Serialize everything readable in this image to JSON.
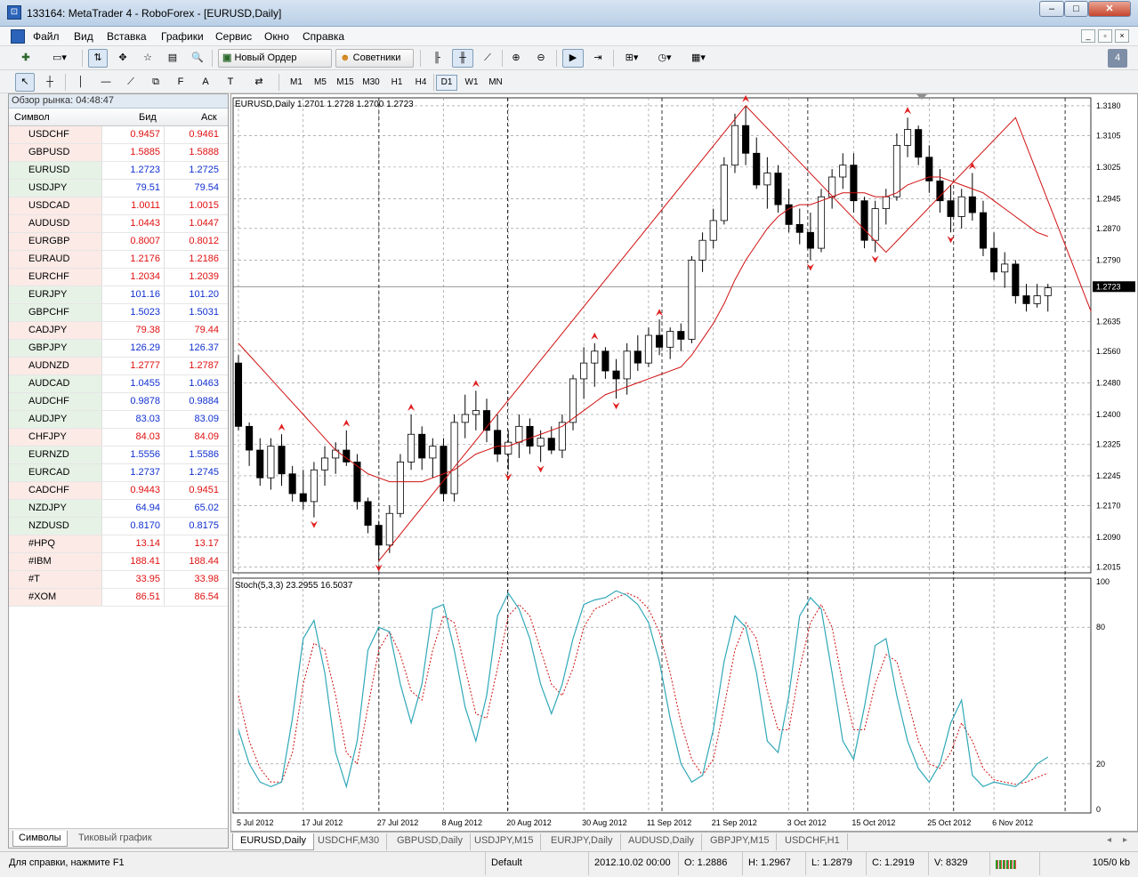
{
  "window": {
    "title": "133164: MetaTrader 4 - RoboForex - [EURUSD,Daily]",
    "icon_glyph": "⊡",
    "buttons": [
      "–",
      "□",
      "✕"
    ]
  },
  "menu": {
    "items": [
      "Файл",
      "Вид",
      "Вставка",
      "Графики",
      "Сервис",
      "Окно",
      "Справка"
    ],
    "mdi_buttons": [
      "_",
      "▫",
      "×"
    ]
  },
  "toolbar": {
    "new_order_label": "Новый Ордер",
    "experts_label": "Советники",
    "periods": [
      "M1",
      "M5",
      "M15",
      "M30",
      "H1",
      "H4",
      "D1",
      "W1",
      "MN"
    ],
    "active_period": "D1",
    "draw_tools": [
      "↖",
      "┼",
      "│",
      "—",
      "⟋",
      "⧉",
      "F",
      "A",
      "T",
      "⇄"
    ],
    "icons": [
      "new-chart-icon",
      "profiles-icon",
      "market-watch-icon",
      "navigator-icon",
      "data-window-icon",
      "terminal-icon",
      "strategy-tester-icon",
      "bar-chart-icon",
      "candle-chart-icon",
      "line-chart-icon",
      "zoom-in-icon",
      "zoom-out-icon",
      "autoscroll-icon",
      "chart-shift-icon",
      "indicators-icon",
      "periods-icon",
      "templates-icon"
    ]
  },
  "market_watch": {
    "title": "Обзор рынка: 04:48:47",
    "headers": {
      "symbol": "Символ",
      "bid": "Бид",
      "ask": "Аск"
    },
    "rows": [
      {
        "symbol": "USDCHF",
        "bid": "0.9457",
        "ask": "0.9461",
        "dir": "down"
      },
      {
        "symbol": "GBPUSD",
        "bid": "1.5885",
        "ask": "1.5888",
        "dir": "down"
      },
      {
        "symbol": "EURUSD",
        "bid": "1.2723",
        "ask": "1.2725",
        "dir": "up"
      },
      {
        "symbol": "USDJPY",
        "bid": "79.51",
        "ask": "79.54",
        "dir": "up"
      },
      {
        "symbol": "USDCAD",
        "bid": "1.0011",
        "ask": "1.0015",
        "dir": "down"
      },
      {
        "symbol": "AUDUSD",
        "bid": "1.0443",
        "ask": "1.0447",
        "dir": "down"
      },
      {
        "symbol": "EURGBP",
        "bid": "0.8007",
        "ask": "0.8012",
        "dir": "down"
      },
      {
        "symbol": "EURAUD",
        "bid": "1.2176",
        "ask": "1.2186",
        "dir": "down"
      },
      {
        "symbol": "EURCHF",
        "bid": "1.2034",
        "ask": "1.2039",
        "dir": "down"
      },
      {
        "symbol": "EURJPY",
        "bid": "101.16",
        "ask": "101.20",
        "dir": "up"
      },
      {
        "symbol": "GBPCHF",
        "bid": "1.5023",
        "ask": "1.5031",
        "dir": "up"
      },
      {
        "symbol": "CADJPY",
        "bid": "79.38",
        "ask": "79.44",
        "dir": "down"
      },
      {
        "symbol": "GBPJPY",
        "bid": "126.29",
        "ask": "126.37",
        "dir": "up"
      },
      {
        "symbol": "AUDNZD",
        "bid": "1.2777",
        "ask": "1.2787",
        "dir": "down"
      },
      {
        "symbol": "AUDCAD",
        "bid": "1.0455",
        "ask": "1.0463",
        "dir": "up"
      },
      {
        "symbol": "AUDCHF",
        "bid": "0.9878",
        "ask": "0.9884",
        "dir": "up"
      },
      {
        "symbol": "AUDJPY",
        "bid": "83.03",
        "ask": "83.09",
        "dir": "up"
      },
      {
        "symbol": "CHFJPY",
        "bid": "84.03",
        "ask": "84.09",
        "dir": "down"
      },
      {
        "symbol": "EURNZD",
        "bid": "1.5556",
        "ask": "1.5586",
        "dir": "up"
      },
      {
        "symbol": "EURCAD",
        "bid": "1.2737",
        "ask": "1.2745",
        "dir": "up"
      },
      {
        "symbol": "CADCHF",
        "bid": "0.9443",
        "ask": "0.9451",
        "dir": "down"
      },
      {
        "symbol": "NZDJPY",
        "bid": "64.94",
        "ask": "65.02",
        "dir": "up"
      },
      {
        "symbol": "NZDUSD",
        "bid": "0.8170",
        "ask": "0.8175",
        "dir": "up"
      },
      {
        "symbol": "#HPQ",
        "bid": "13.14",
        "ask": "13.17",
        "dir": "down"
      },
      {
        "symbol": "#IBM",
        "bid": "188.41",
        "ask": "188.44",
        "dir": "down"
      },
      {
        "symbol": "#T",
        "bid": "33.95",
        "ask": "33.98",
        "dir": "down"
      },
      {
        "symbol": "#XOM",
        "bid": "86.51",
        "ask": "86.54",
        "dir": "down"
      }
    ],
    "tabs": [
      "Символы",
      "Тиковый график"
    ]
  },
  "chart": {
    "header": "EURUSD,Daily  1.2701 1.2728 1.2700 1.2723",
    "current_price": "1.2723",
    "price_labels": [
      "1.3180",
      "1.3105",
      "1.3025",
      "1.2945",
      "1.2870",
      "1.2790",
      "1.2635",
      "1.2560",
      "1.2480",
      "1.2400",
      "1.2325",
      "1.2245",
      "1.2170",
      "1.2090",
      "1.2015"
    ],
    "date_labels": [
      "5 Jul 2012",
      "17 Jul 2012",
      "27 Jul 2012",
      "8 Aug 2012",
      "20 Aug 2012",
      "30 Aug 2012",
      "11 Sep 2012",
      "21 Sep 2012",
      "3 Oct 2012",
      "15 Oct 2012",
      "25 Oct 2012",
      "6 Nov 2012"
    ],
    "stoch_header": "Stoch(5,3,3) 23.2955 16.5037",
    "stoch_levels": [
      "100",
      "80",
      "20",
      "0"
    ],
    "colors": {
      "bull": "#ffffff",
      "bear": "#000000",
      "ma": "#d01010",
      "zigzag": "#d01010",
      "stoch_main": "#30a8b8",
      "stoch_signal": "#d01010",
      "grid": "#888888"
    }
  },
  "chart_data": {
    "type": "candlestick",
    "symbol": "EURUSD",
    "timeframe": "Daily",
    "ylim": [
      1.2,
      1.32
    ],
    "candles": [
      [
        1.253,
        1.255,
        1.236,
        1.237
      ],
      [
        1.237,
        1.238,
        1.227,
        1.231
      ],
      [
        1.231,
        1.234,
        1.222,
        1.224
      ],
      [
        1.224,
        1.234,
        1.221,
        1.232
      ],
      [
        1.232,
        1.235,
        1.222,
        1.225
      ],
      [
        1.225,
        1.227,
        1.218,
        1.22
      ],
      [
        1.22,
        1.226,
        1.216,
        1.218
      ],
      [
        1.218,
        1.228,
        1.214,
        1.226
      ],
      [
        1.226,
        1.232,
        1.222,
        1.229
      ],
      [
        1.229,
        1.233,
        1.225,
        1.231
      ],
      [
        1.231,
        1.236,
        1.227,
        1.228
      ],
      [
        1.228,
        1.23,
        1.216,
        1.218
      ],
      [
        1.218,
        1.219,
        1.21,
        1.212
      ],
      [
        1.212,
        1.213,
        1.203,
        1.207
      ],
      [
        1.207,
        1.217,
        1.205,
        1.215
      ],
      [
        1.215,
        1.23,
        1.214,
        1.228
      ],
      [
        1.228,
        1.24,
        1.226,
        1.235
      ],
      [
        1.235,
        1.237,
        1.226,
        1.229
      ],
      [
        1.229,
        1.234,
        1.224,
        1.232
      ],
      [
        1.232,
        1.234,
        1.218,
        1.22
      ],
      [
        1.22,
        1.24,
        1.218,
        1.238
      ],
      [
        1.238,
        1.245,
        1.234,
        1.24
      ],
      [
        1.24,
        1.246,
        1.236,
        1.241
      ],
      [
        1.241,
        1.244,
        1.233,
        1.236
      ],
      [
        1.236,
        1.24,
        1.228,
        1.23
      ],
      [
        1.23,
        1.236,
        1.226,
        1.233
      ],
      [
        1.233,
        1.24,
        1.229,
        1.237
      ],
      [
        1.237,
        1.239,
        1.23,
        1.232
      ],
      [
        1.232,
        1.236,
        1.228,
        1.234
      ],
      [
        1.234,
        1.237,
        1.23,
        1.231
      ],
      [
        1.231,
        1.24,
        1.229,
        1.238
      ],
      [
        1.238,
        1.25,
        1.236,
        1.249
      ],
      [
        1.249,
        1.257,
        1.244,
        1.253
      ],
      [
        1.253,
        1.258,
        1.247,
        1.256
      ],
      [
        1.256,
        1.257,
        1.249,
        1.251
      ],
      [
        1.251,
        1.254,
        1.244,
        1.249
      ],
      [
        1.249,
        1.258,
        1.245,
        1.256
      ],
      [
        1.256,
        1.26,
        1.251,
        1.253
      ],
      [
        1.253,
        1.262,
        1.252,
        1.26
      ],
      [
        1.26,
        1.264,
        1.255,
        1.257
      ],
      [
        1.257,
        1.262,
        1.254,
        1.261
      ],
      [
        1.261,
        1.263,
        1.256,
        1.259
      ],
      [
        1.259,
        1.28,
        1.258,
        1.279
      ],
      [
        1.279,
        1.286,
        1.276,
        1.284
      ],
      [
        1.284,
        1.292,
        1.282,
        1.289
      ],
      [
        1.289,
        1.305,
        1.288,
        1.303
      ],
      [
        1.303,
        1.316,
        1.301,
        1.313
      ],
      [
        1.313,
        1.318,
        1.303,
        1.306
      ],
      [
        1.306,
        1.31,
        1.297,
        1.298
      ],
      [
        1.298,
        1.305,
        1.292,
        1.301
      ],
      [
        1.301,
        1.303,
        1.291,
        1.293
      ],
      [
        1.293,
        1.297,
        1.286,
        1.288
      ],
      [
        1.288,
        1.292,
        1.283,
        1.286
      ],
      [
        1.286,
        1.291,
        1.279,
        1.282
      ],
      [
        1.282,
        1.297,
        1.281,
        1.295
      ],
      [
        1.295,
        1.302,
        1.292,
        1.3
      ],
      [
        1.3,
        1.306,
        1.297,
        1.303
      ],
      [
        1.303,
        1.306,
        1.291,
        1.294
      ],
      [
        1.294,
        1.295,
        1.282,
        1.284
      ],
      [
        1.284,
        1.294,
        1.281,
        1.292
      ],
      [
        1.292,
        1.297,
        1.288,
        1.295
      ],
      [
        1.295,
        1.311,
        1.294,
        1.308
      ],
      [
        1.308,
        1.315,
        1.305,
        1.312
      ],
      [
        1.312,
        1.313,
        1.303,
        1.305
      ],
      [
        1.305,
        1.308,
        1.296,
        1.299
      ],
      [
        1.299,
        1.302,
        1.291,
        1.294
      ],
      [
        1.294,
        1.298,
        1.286,
        1.29
      ],
      [
        1.29,
        1.297,
        1.287,
        1.295
      ],
      [
        1.295,
        1.301,
        1.289,
        1.291
      ],
      [
        1.291,
        1.294,
        1.28,
        1.282
      ],
      [
        1.282,
        1.286,
        1.274,
        1.276
      ],
      [
        1.276,
        1.281,
        1.272,
        1.278
      ],
      [
        1.278,
        1.279,
        1.268,
        1.27
      ],
      [
        1.27,
        1.273,
        1.266,
        1.268
      ],
      [
        1.268,
        1.273,
        1.267,
        1.27
      ],
      [
        1.27,
        1.273,
        1.266,
        1.272
      ]
    ],
    "moving_average": [
      1.258,
      1.255,
      1.252,
      1.249,
      1.246,
      1.243,
      1.24,
      1.237,
      1.234,
      1.231,
      1.229,
      1.227,
      1.225,
      1.224,
      1.223,
      1.223,
      1.223,
      1.223,
      1.224,
      1.225,
      1.226,
      1.228,
      1.23,
      1.231,
      1.232,
      1.232,
      1.233,
      1.234,
      1.235,
      1.236,
      1.237,
      1.239,
      1.241,
      1.243,
      1.245,
      1.246,
      1.247,
      1.248,
      1.249,
      1.25,
      1.251,
      1.252,
      1.255,
      1.259,
      1.263,
      1.268,
      1.274,
      1.279,
      1.283,
      1.287,
      1.29,
      1.292,
      1.293,
      1.293,
      1.294,
      1.295,
      1.296,
      1.296,
      1.296,
      1.295,
      1.295,
      1.296,
      1.298,
      1.299,
      1.3,
      1.3,
      1.299,
      1.298,
      1.297,
      1.296,
      1.294,
      1.292,
      1.29,
      1.288,
      1.286,
      1.285
    ],
    "zigzag": [
      [
        13,
        1.203
      ],
      [
        47,
        1.318
      ],
      [
        60,
        1.281
      ],
      [
        72,
        1.315
      ],
      [
        79,
        1.266
      ]
    ],
    "stochastic": {
      "main": [
        35,
        20,
        12,
        10,
        12,
        40,
        75,
        83,
        60,
        25,
        10,
        30,
        70,
        80,
        78,
        55,
        38,
        55,
        88,
        90,
        70,
        45,
        30,
        50,
        85,
        95,
        88,
        75,
        55,
        42,
        55,
        75,
        90,
        92,
        93,
        96,
        94,
        90,
        82,
        65,
        40,
        20,
        12,
        15,
        35,
        65,
        85,
        80,
        60,
        30,
        25,
        50,
        85,
        93,
        88,
        60,
        30,
        22,
        45,
        72,
        75,
        50,
        30,
        18,
        12,
        20,
        38,
        48,
        15,
        10,
        12,
        11,
        10,
        14,
        20,
        23
      ],
      "signal": [
        50,
        30,
        18,
        12,
        12,
        25,
        55,
        73,
        70,
        50,
        25,
        20,
        45,
        70,
        78,
        68,
        52,
        48,
        70,
        85,
        82,
        62,
        42,
        40,
        62,
        85,
        90,
        85,
        70,
        55,
        50,
        62,
        80,
        88,
        90,
        93,
        95,
        93,
        88,
        78,
        60,
        38,
        22,
        15,
        22,
        45,
        70,
        82,
        75,
        52,
        35,
        35,
        62,
        82,
        90,
        80,
        55,
        35,
        35,
        55,
        68,
        65,
        48,
        30,
        20,
        18,
        25,
        38,
        30,
        18,
        13,
        12,
        11,
        12,
        14,
        16
      ],
      "levels": [
        20,
        80
      ]
    }
  },
  "chart_tabs": [
    "EURUSD,Daily",
    "USDCHF,M30",
    "GBPUSD,Daily",
    "USDJPY,M15",
    "EURJPY,Daily",
    "AUDUSD,Daily",
    "GBPJPY,M15",
    "USDCHF,H1"
  ],
  "status": {
    "help": "Для справки, нажмите F1",
    "profile": "Default",
    "datetime": "2012.10.02 00:00",
    "open": "O: 1.2886",
    "high": "H: 1.2967",
    "low": "L: 1.2879",
    "close": "C: 1.2919",
    "volume": "V: 8329",
    "traffic": "105/0 kb"
  }
}
